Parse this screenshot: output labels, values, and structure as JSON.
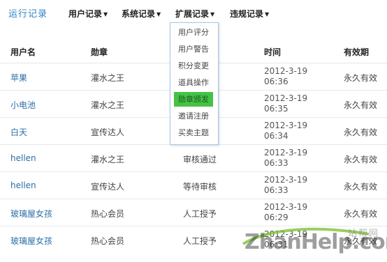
{
  "nav": {
    "title": "运行记录",
    "items": [
      {
        "label": "用户记录",
        "caret": "▼"
      },
      {
        "label": "系统记录",
        "caret": "▼"
      },
      {
        "label": "扩展记录",
        "caret": "▼"
      },
      {
        "label": "违规记录",
        "caret": "▼"
      }
    ]
  },
  "table": {
    "headers": [
      "用户名",
      "勋章",
      "时间",
      "有效期"
    ],
    "rows": [
      {
        "user": "苹果",
        "medal": "灌水之王",
        "op": "",
        "time1": "2012-3-19",
        "time2": "06:36",
        "valid": "永久有效"
      },
      {
        "user": "小电池",
        "medal": "灌水之王",
        "op": "",
        "time1": "2012-3-19",
        "time2": "06:35",
        "valid": "永久有效"
      },
      {
        "user": "白天",
        "medal": "宣传达人",
        "op": "",
        "time1": "2012-3-19",
        "time2": "06:34",
        "valid": "永久有效"
      },
      {
        "user": "hellen",
        "medal": "灌水之王",
        "op": "审核通过",
        "time1": "2012-3-19",
        "time2": "06:33",
        "valid": "永久有效"
      },
      {
        "user": "hellen",
        "medal": "宣传达人",
        "op": "等待审核",
        "time1": "2012-3-19",
        "time2": "06:33",
        "valid": "永久有效"
      },
      {
        "user": "玻璃屋女孩",
        "medal": "热心会员",
        "op": "人工授予",
        "time1": "2012-3-19",
        "time2": "06:29",
        "valid": "永久有效"
      },
      {
        "user": "玻璃屋女孩",
        "medal": "热心会员",
        "op": "人工授予",
        "time1": "2012-3-19",
        "time2": "06:31",
        "valid": "永久有效"
      }
    ]
  },
  "dropdown": {
    "items": [
      "用户评分",
      "用户警告",
      "积分变更",
      "道具操作",
      "勋章颁发",
      "邀请注册",
      "买卖主题"
    ],
    "active": "勋章颁发"
  },
  "watermark": {
    "big": "ZhanHelp.com",
    "small": "站帮网"
  },
  "colors": {
    "link": "#2a6ea8",
    "title": "#2a84c0",
    "active_item": "#46c246",
    "dropdown_border": "#a9c7df"
  }
}
